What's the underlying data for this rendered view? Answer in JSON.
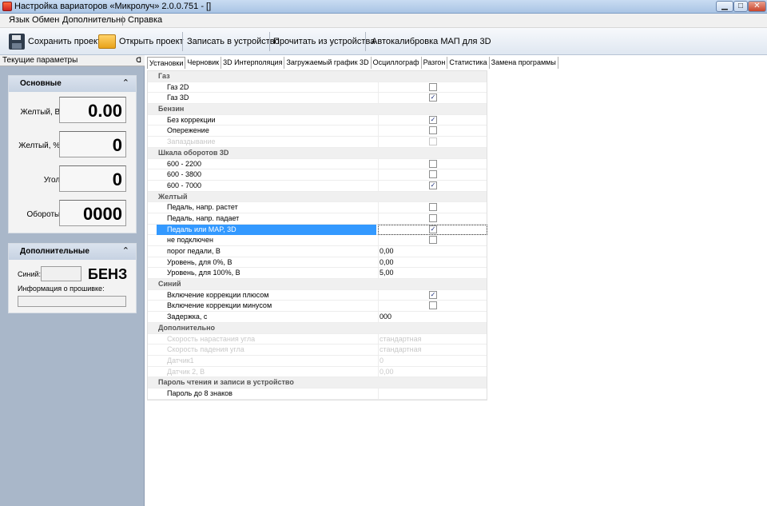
{
  "window": {
    "title": "Настройка вариаторов «Микролуч» 2.0.0.751 - []"
  },
  "menu": [
    "Язык",
    "Обмен",
    "Дополнительно",
    "Справка"
  ],
  "toolbar": {
    "save_label": "Сохранить проект",
    "open_label": "Открыть проект",
    "write_label": "Записать в устройство",
    "read_label": "Прочитать из устройства",
    "autocal_label": "Автокалибровка МАП для 3D"
  },
  "left_panel": {
    "title": "Текущие параметры",
    "main_group": {
      "title": "Основные",
      "params": [
        {
          "label": "Желтый, В:",
          "value": "0.00"
        },
        {
          "label": "Желтый, %:",
          "value": "0"
        },
        {
          "label": "Угол:",
          "value": "0"
        },
        {
          "label": "Обороты:",
          "value": "0000"
        }
      ]
    },
    "extra_group": {
      "title": "Дополнительные",
      "blue_label": "Синий:",
      "fuel_text": "БЕНЗ",
      "firmware_label": "Информация о прошивке:"
    }
  },
  "tabs": [
    "Установки",
    "Черновик",
    "3D Интерполяция",
    "Загружаемый график 3D",
    "Осциллограф",
    "Разгон",
    "Статистика",
    "Замена программы"
  ],
  "settings": [
    {
      "kind": "cat",
      "label": "Газ"
    },
    {
      "kind": "check",
      "label": "Газ 2D",
      "checked": false
    },
    {
      "kind": "check",
      "label": "Газ 3D",
      "checked": true
    },
    {
      "kind": "cat",
      "label": "Бензин"
    },
    {
      "kind": "check",
      "label": "Без коррекции",
      "checked": true
    },
    {
      "kind": "check",
      "label": "Опережение",
      "checked": false
    },
    {
      "kind": "check",
      "label": "Запаздывание",
      "checked": false,
      "disabled": true
    },
    {
      "kind": "cat",
      "label": "Шкала оборотов 3D"
    },
    {
      "kind": "check",
      "label": "600 - 2200",
      "checked": false
    },
    {
      "kind": "check",
      "label": "600 - 3800",
      "checked": false
    },
    {
      "kind": "check",
      "label": "600 - 7000",
      "checked": true
    },
    {
      "kind": "cat",
      "label": "Желтый"
    },
    {
      "kind": "check",
      "label": "Педаль, напр. растет",
      "checked": false
    },
    {
      "kind": "check",
      "label": "Педаль, напр. падает",
      "checked": false
    },
    {
      "kind": "check",
      "label": "Педаль или MAP, 3D",
      "checked": true,
      "selected": true
    },
    {
      "kind": "check",
      "label": "не подключен",
      "checked": false
    },
    {
      "kind": "text",
      "label": "порог педали, В",
      "value": "0,00"
    },
    {
      "kind": "text",
      "label": "Уровень, для 0%, В",
      "value": "0,00"
    },
    {
      "kind": "text",
      "label": "Уровень, для 100%, В",
      "value": "5,00"
    },
    {
      "kind": "cat",
      "label": "Синий"
    },
    {
      "kind": "check",
      "label": "Включение коррекции плюсом",
      "checked": true
    },
    {
      "kind": "check",
      "label": "Включение коррекции минусом",
      "checked": false
    },
    {
      "kind": "text",
      "label": "Задержка, с",
      "value": "000"
    },
    {
      "kind": "cat",
      "label": "Дополнительно"
    },
    {
      "kind": "text",
      "label": "Скорость нарастания угла",
      "value": "стандартная",
      "disabled": true
    },
    {
      "kind": "text",
      "label": "Скорость падения угла",
      "value": "стандартная",
      "disabled": true
    },
    {
      "kind": "text",
      "label": "Датчик1",
      "value": "0",
      "disabled": true
    },
    {
      "kind": "text",
      "label": "Датчик 2, В",
      "value": "0,00",
      "disabled": true
    },
    {
      "kind": "cat",
      "label": "Пароль чтения и записи в устройство"
    },
    {
      "kind": "text",
      "label": "Пароль до 8 знаков",
      "value": ""
    }
  ]
}
